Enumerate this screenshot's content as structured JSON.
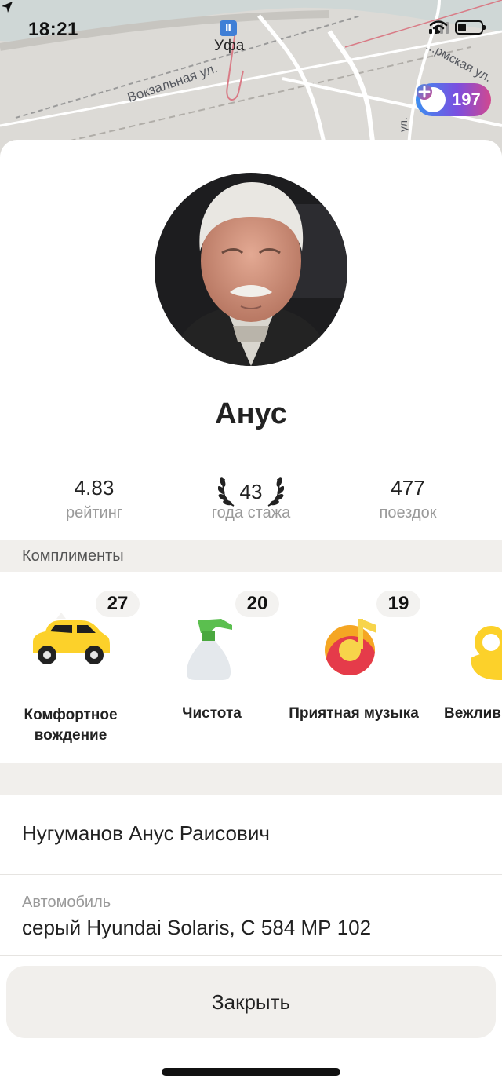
{
  "status_bar": {
    "time": "18:21",
    "location_icon": "location-arrow-icon",
    "signal_icon": "cellular-signal-icon",
    "wifi_icon": "wifi-icon",
    "battery_icon": "battery-icon",
    "battery_level": 0.35
  },
  "map": {
    "city_label": "Уфа",
    "city_icon_text": "Ⅱ",
    "streets": [
      "Вокзальная ул.",
      "...рмская ул.",
      "ул."
    ],
    "plus": {
      "icon": "yandex-plus-icon",
      "count": "197",
      "gradient": [
        "#3c8ef0",
        "#7a4fe0",
        "#d1488f"
      ]
    }
  },
  "driver": {
    "avatar_icon": "driver-avatar-photo",
    "name": "Анус",
    "full_name": "Нугуманов Анус Раисович"
  },
  "stats": [
    {
      "value": "4.83",
      "label": "рейтинг"
    },
    {
      "value": "43",
      "label": "года стажа",
      "icon": "laurel-wreath-icon"
    },
    {
      "value": "477",
      "label": "поездок"
    }
  ],
  "compliments": {
    "header": "Комплименты",
    "items": [
      {
        "count": "27",
        "label": "Комфортное вождение",
        "icon": "taxi-car-icon"
      },
      {
        "count": "20",
        "label": "Чистота",
        "icon": "spray-bottle-icon"
      },
      {
        "count": "19",
        "label": "Приятная музыка",
        "icon": "music-note-icon"
      },
      {
        "count": "",
        "label": "Вежлив",
        "icon": "ok-hand-icon"
      }
    ]
  },
  "car": {
    "label": "Автомобиль",
    "value": "серый Hyundai Solaris, С 584 МР 102"
  },
  "close_button": "Закрыть",
  "colors": {
    "accent_yellow": "#fcd12a",
    "sheet_background": "#ffffff",
    "section_background": "#f1efec",
    "muted_text": "#9a9a9a"
  }
}
